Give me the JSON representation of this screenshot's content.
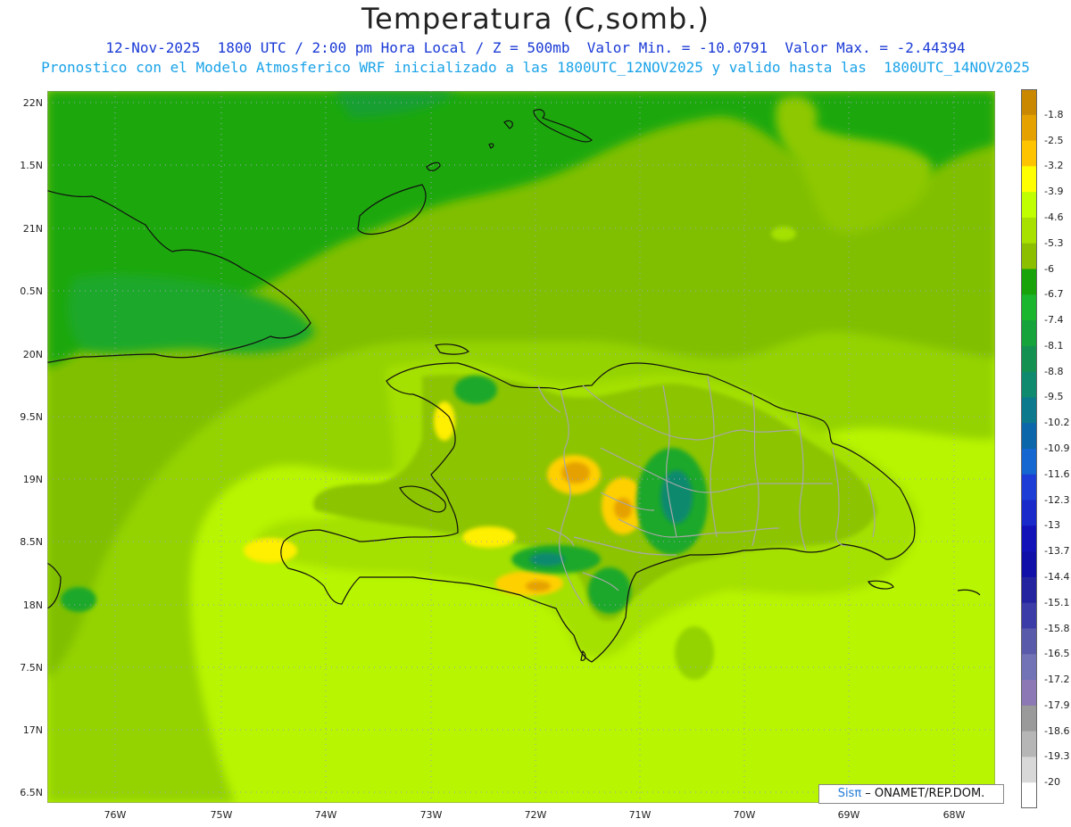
{
  "header": {
    "title": "Temperatura (C,somb.)",
    "subtitle_line1": "12-Nov-2025  1800 UTC / 2:00 pm Hora Local / Z = 500mb  Valor Min. = -10.0791  Valor Max. = -2.44394",
    "subtitle_line2": "Pronostico con el Modelo Atmosferico WRF inicializado a las 1800UTC_12NOV2025 y valido hasta las  1800UTC_14NOV2025"
  },
  "axes": {
    "lat_labels": [
      "22N",
      "1.5N",
      "21N",
      "0.5N",
      "20N",
      "9.5N",
      "19N",
      "8.5N",
      "18N",
      "7.5N",
      "17N",
      "6.5N"
    ],
    "lon_labels": [
      "76W",
      "75W",
      "74W",
      "73W",
      "72W",
      "71W",
      "70W",
      "69W",
      "68W"
    ]
  },
  "colorbar": {
    "labels": [
      "-1.8",
      "-2.5",
      "-3.2",
      "-3.9",
      "-4.6",
      "-5.3",
      "-6",
      "-6.7",
      "-7.4",
      "-8.1",
      "-8.8",
      "-9.5",
      "-10.2",
      "-10.9",
      "-11.6",
      "-12.3",
      "-13",
      "-13.7",
      "-14.4",
      "-15.1",
      "-15.8",
      "-16.5",
      "-17.2",
      "-17.9",
      "-18.6",
      "-19.3",
      "-20"
    ],
    "colors": [
      "#c98800",
      "#e5a100",
      "#ffc400",
      "#ffff00",
      "#c0ff00",
      "#a8e000",
      "#8cbf00",
      "#19a30a",
      "#1bb52e",
      "#16a33c",
      "#149150",
      "#108a6e",
      "#0c7a8c",
      "#0c66aa",
      "#1466d0",
      "#1c3dd6",
      "#1a29c9",
      "#1212b8",
      "#1010a8",
      "#2323a0",
      "#3c3ca8",
      "#5a5aaa",
      "#7272b6",
      "#8c78b4",
      "#9a9a9a",
      "#b6b6b6",
      "#d8d8d8",
      "#ffffff"
    ]
  },
  "credit": {
    "brand": "Sisπ",
    "separator": " – ",
    "org": "ONAMET/REP.DOM."
  },
  "colors": {
    "title": "#222222",
    "subtitle1": "#1a3ad6",
    "subtitle2": "#1aa3e8"
  }
}
